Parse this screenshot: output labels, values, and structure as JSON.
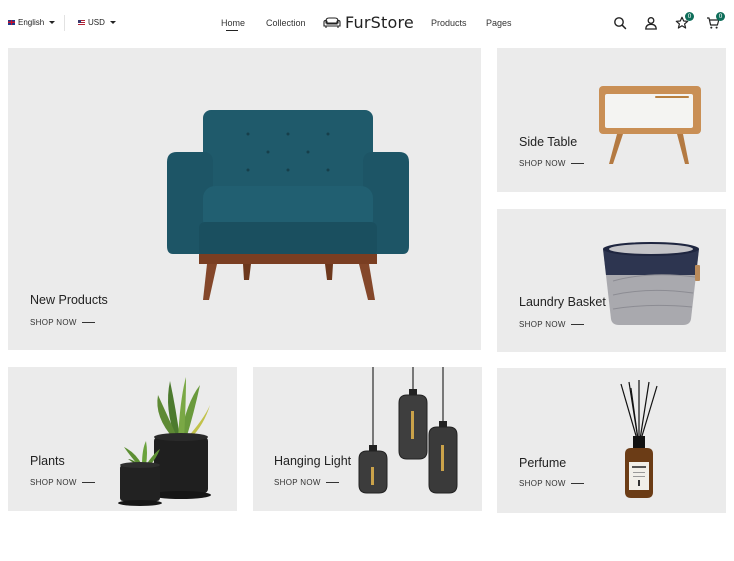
{
  "header": {
    "language": "English",
    "currency": "USD",
    "nav": {
      "home": "Home",
      "collection": "Collection",
      "products": "Products",
      "pages": "Pages"
    },
    "logo": "FurStore",
    "wishlist_count": "0",
    "cart_count": "0"
  },
  "tiles": {
    "new_products": {
      "title": "New Products",
      "cta": "SHOP NOW"
    },
    "side_table": {
      "title": "Side Table",
      "cta": "SHOP NOW"
    },
    "laundry_basket": {
      "title": "Laundry Basket",
      "cta": "SHOP NOW"
    },
    "plants": {
      "title": "Plants",
      "cta": "SHOP NOW"
    },
    "hanging_light": {
      "title": "Hanging Light",
      "cta": "SHOP NOW"
    },
    "perfume": {
      "title": "Perfume",
      "cta": "SHOP NOW"
    }
  },
  "colors": {
    "accent": "#0f6e5a",
    "tile_background": "#ebebeb",
    "armchair": "#1f5a6b"
  }
}
